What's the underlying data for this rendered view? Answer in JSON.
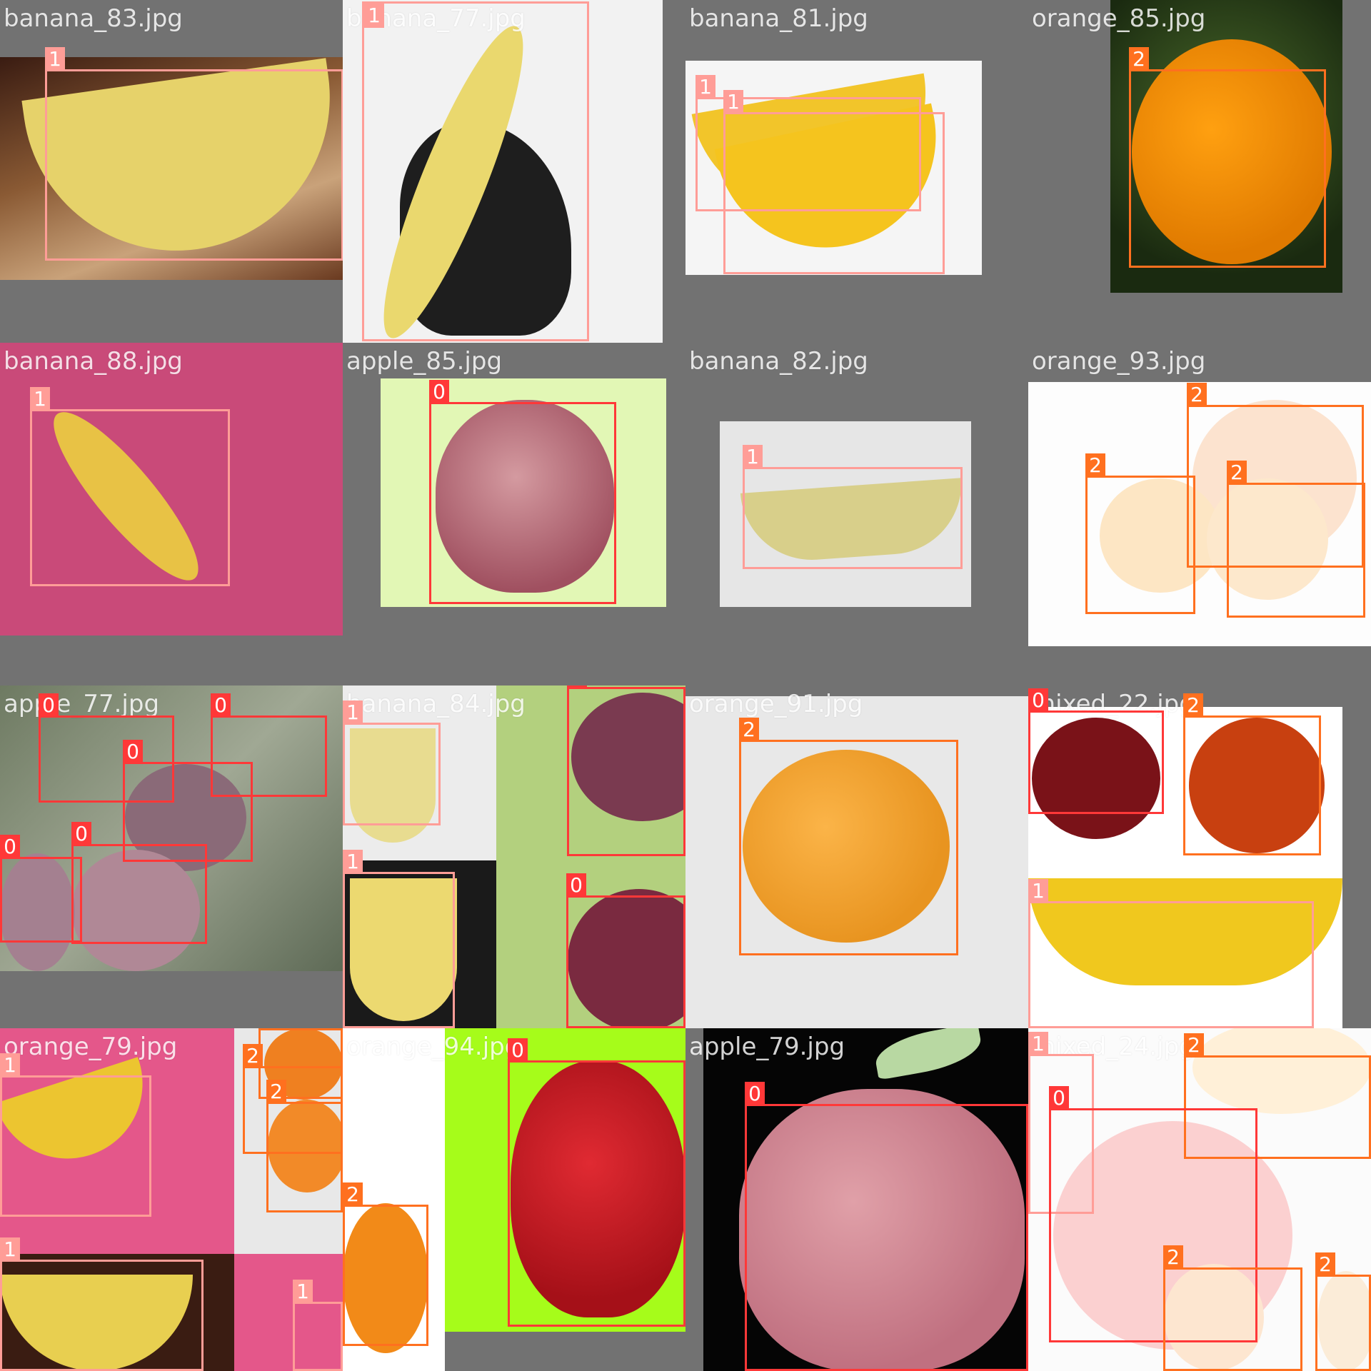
{
  "class_colors": {
    "0": "#ff3838",
    "1": "#ff9d97",
    "2": "#ff701f"
  },
  "tiles": [
    {
      "caption": "banana_83.jpg",
      "detections": [
        {
          "cls": "1"
        }
      ]
    },
    {
      "caption": "banana_77.jpg",
      "detections": [
        {
          "cls": "1"
        }
      ]
    },
    {
      "caption": "banana_81.jpg",
      "detections": [
        {
          "cls": "1"
        },
        {
          "cls": "1"
        }
      ]
    },
    {
      "caption": "orange_85.jpg",
      "detections": [
        {
          "cls": "2"
        }
      ]
    },
    {
      "caption": "banana_88.jpg",
      "detections": [
        {
          "cls": "1"
        }
      ]
    },
    {
      "caption": "apple_85.jpg",
      "detections": [
        {
          "cls": "0"
        }
      ]
    },
    {
      "caption": "banana_82.jpg",
      "detections": [
        {
          "cls": "1"
        }
      ]
    },
    {
      "caption": "orange_93.jpg",
      "detections": [
        {
          "cls": "2"
        },
        {
          "cls": "2"
        },
        {
          "cls": "2"
        }
      ]
    },
    {
      "caption": "apple_77.jpg",
      "detections": [
        {
          "cls": "0"
        },
        {
          "cls": "0"
        },
        {
          "cls": "0"
        },
        {
          "cls": "0"
        },
        {
          "cls": "0"
        }
      ]
    },
    {
      "caption": "banana_84.jpg",
      "detections": [
        {
          "cls": "1"
        },
        {
          "cls": "1"
        },
        {
          "cls": "0"
        },
        {
          "cls": "0"
        }
      ]
    },
    {
      "caption": "orange_91.jpg",
      "detections": [
        {
          "cls": "2"
        }
      ]
    },
    {
      "caption": "mixed_22.jpg",
      "detections": [
        {
          "cls": "0"
        },
        {
          "cls": "2"
        },
        {
          "cls": "1"
        }
      ]
    },
    {
      "caption": "orange_79.jpg",
      "detections": [
        {
          "cls": "1"
        },
        {
          "cls": "2"
        },
        {
          "cls": "2"
        },
        {
          "cls": "2"
        },
        {
          "cls": "1"
        },
        {
          "cls": "1"
        }
      ]
    },
    {
      "caption": "orange_94.jpg",
      "detections": [
        {
          "cls": "0"
        },
        {
          "cls": "2"
        }
      ]
    },
    {
      "caption": "apple_79.jpg",
      "detections": [
        {
          "cls": "0"
        }
      ]
    },
    {
      "caption": "mixed_24.jpg",
      "detections": [
        {
          "cls": "1"
        },
        {
          "cls": "2"
        },
        {
          "cls": "0"
        },
        {
          "cls": "2"
        },
        {
          "cls": "2"
        }
      ]
    }
  ]
}
